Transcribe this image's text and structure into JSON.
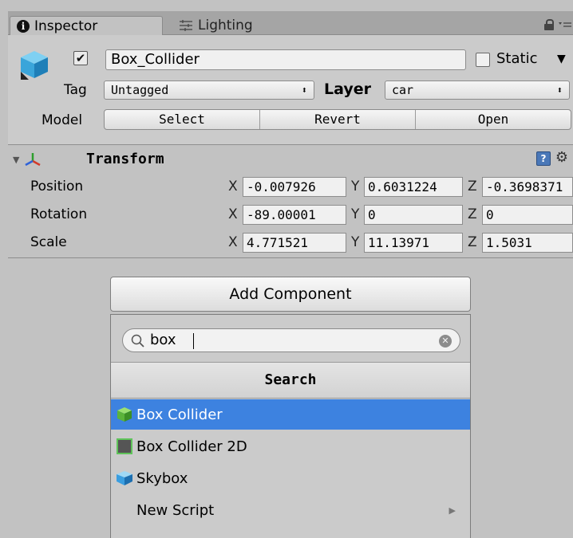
{
  "tabs": {
    "inspector": "Inspector",
    "lighting": "Lighting"
  },
  "object": {
    "name": "Box_Collider",
    "active": true,
    "static_label": "Static",
    "static": false,
    "tag_label": "Tag",
    "tag_value": "Untagged",
    "layer_label": "Layer",
    "layer_value": "car",
    "model_label": "Model",
    "model_buttons": [
      "Select",
      "Revert",
      "Open"
    ]
  },
  "transform": {
    "title": "Transform",
    "rows": [
      {
        "label": "Position",
        "x": "-0.007926",
        "y": "0.6031224",
        "z": "-0.3698371"
      },
      {
        "label": "Rotation",
        "x": "-89.00001",
        "y": "0",
        "z": "0"
      },
      {
        "label": "Scale",
        "x": "4.771521",
        "y": "11.13971",
        "z": "1.5031"
      }
    ],
    "axis_labels": [
      "X",
      "Y",
      "Z"
    ]
  },
  "add_component": {
    "button_label": "Add Component",
    "search_value": "box",
    "section_title": "Search",
    "results": [
      {
        "label": "Box Collider",
        "icon": "box-collider-icon",
        "selected": true
      },
      {
        "label": "Box Collider 2D",
        "icon": "box-collider-2d-icon",
        "selected": false
      },
      {
        "label": "Skybox",
        "icon": "skybox-icon",
        "selected": false
      },
      {
        "label": "New Script",
        "icon": "",
        "selected": false,
        "has_submenu": true
      }
    ]
  },
  "colors": {
    "selection": "#3d82e0",
    "panel": "#c2c2c2"
  }
}
